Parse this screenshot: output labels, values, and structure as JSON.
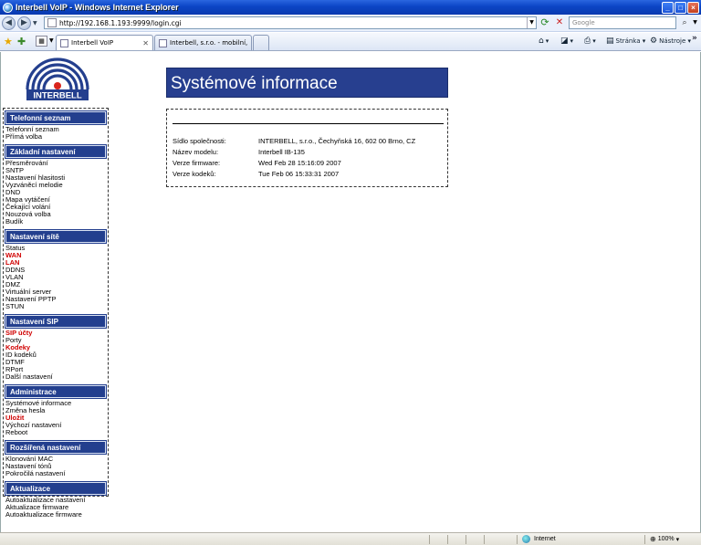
{
  "window": {
    "title": "Interbell VoIP - Windows Internet Explorer"
  },
  "browser": {
    "url": "http://192.168.1.193:9999/login.cgi",
    "search_placeholder": "Google",
    "tabs": [
      {
        "label": "Interbell VoIP",
        "active": true
      },
      {
        "label": "Interbell, s.r.o. - mobilní, bez...",
        "active": false
      }
    ],
    "commands": {
      "page": "Stránka",
      "tools": "Nástroje"
    },
    "status": {
      "zone": "Internet",
      "zoom": "100%"
    }
  },
  "logo": {
    "text": "INTERBELL"
  },
  "sidebar": [
    {
      "title": "Telefonní seznam",
      "links": [
        {
          "label": "Telefonní seznam",
          "highlight": false
        },
        {
          "label": "Přímá volba",
          "highlight": false
        }
      ]
    },
    {
      "title": "Základní nastavení",
      "links": [
        {
          "label": "Přesměrování",
          "highlight": false
        },
        {
          "label": "SNTP",
          "highlight": false
        },
        {
          "label": "Nastavení hlasitosti",
          "highlight": false
        },
        {
          "label": "Vyzváněcí melodie",
          "highlight": false
        },
        {
          "label": "DND",
          "highlight": false
        },
        {
          "label": "Mapa vytáčení",
          "highlight": false
        },
        {
          "label": "Čekající volání",
          "highlight": false
        },
        {
          "label": "Nouzová volba",
          "highlight": false
        },
        {
          "label": "Budík",
          "highlight": false
        }
      ]
    },
    {
      "title": "Nastavení sítě",
      "links": [
        {
          "label": "Status",
          "highlight": false
        },
        {
          "label": "WAN",
          "highlight": true
        },
        {
          "label": "LAN",
          "highlight": true
        },
        {
          "label": "DDNS",
          "highlight": false
        },
        {
          "label": "VLAN",
          "highlight": false
        },
        {
          "label": "DMZ",
          "highlight": false
        },
        {
          "label": "Virtuální server",
          "highlight": false
        },
        {
          "label": "Nastavení PPTP",
          "highlight": false
        },
        {
          "label": "STUN",
          "highlight": false
        }
      ]
    },
    {
      "title": "Nastavení SIP",
      "links": [
        {
          "label": "SIP účty",
          "highlight": true
        },
        {
          "label": "Porty",
          "highlight": false
        },
        {
          "label": "Kodeky",
          "highlight": true
        },
        {
          "label": "ID kodeků",
          "highlight": false
        },
        {
          "label": "DTMF",
          "highlight": false
        },
        {
          "label": "RPort",
          "highlight": false
        },
        {
          "label": "Další nastavení",
          "highlight": false
        }
      ]
    },
    {
      "title": "Administrace",
      "links": [
        {
          "label": "Systémové informace",
          "highlight": false
        },
        {
          "label": "Změna hesla",
          "highlight": false
        },
        {
          "label": "Uložit",
          "highlight": true
        },
        {
          "label": "Výchozí nastavení",
          "highlight": false
        },
        {
          "label": "Reboot",
          "highlight": false
        }
      ]
    },
    {
      "title": "Rozšířená nastavení",
      "links": [
        {
          "label": "Klonování MAC",
          "highlight": false
        },
        {
          "label": "Nastavení tónů",
          "highlight": false
        },
        {
          "label": "Pokročilá nastavení",
          "highlight": false
        }
      ]
    },
    {
      "title": "Aktualizace",
      "links": [
        {
          "label": "Autoaktualizace nastavení",
          "highlight": false
        },
        {
          "label": "Aktualizace firmware",
          "highlight": false
        },
        {
          "label": "Autoaktualizace firmware",
          "highlight": false
        }
      ]
    }
  ],
  "main": {
    "heading": "Systémové informace",
    "info": [
      {
        "label": "Sídlo společnosti:",
        "value": "INTERBELL, s.r.o., Čechyňská 16, 602 00 Brno, CZ"
      },
      {
        "label": "Název modelu:",
        "value": "Interbell IB-135"
      },
      {
        "label": "Verze firmware:",
        "value": "Wed Feb 28 15:16:09 2007"
      },
      {
        "label": "Verze kodeků:",
        "value": "Tue Feb 06 15:33:31 2007"
      }
    ]
  },
  "colors": {
    "nav_header": "#233f8e",
    "highlight_link": "#d00000",
    "logo_red": "#d9251c",
    "logo_blue": "#243f8e"
  }
}
